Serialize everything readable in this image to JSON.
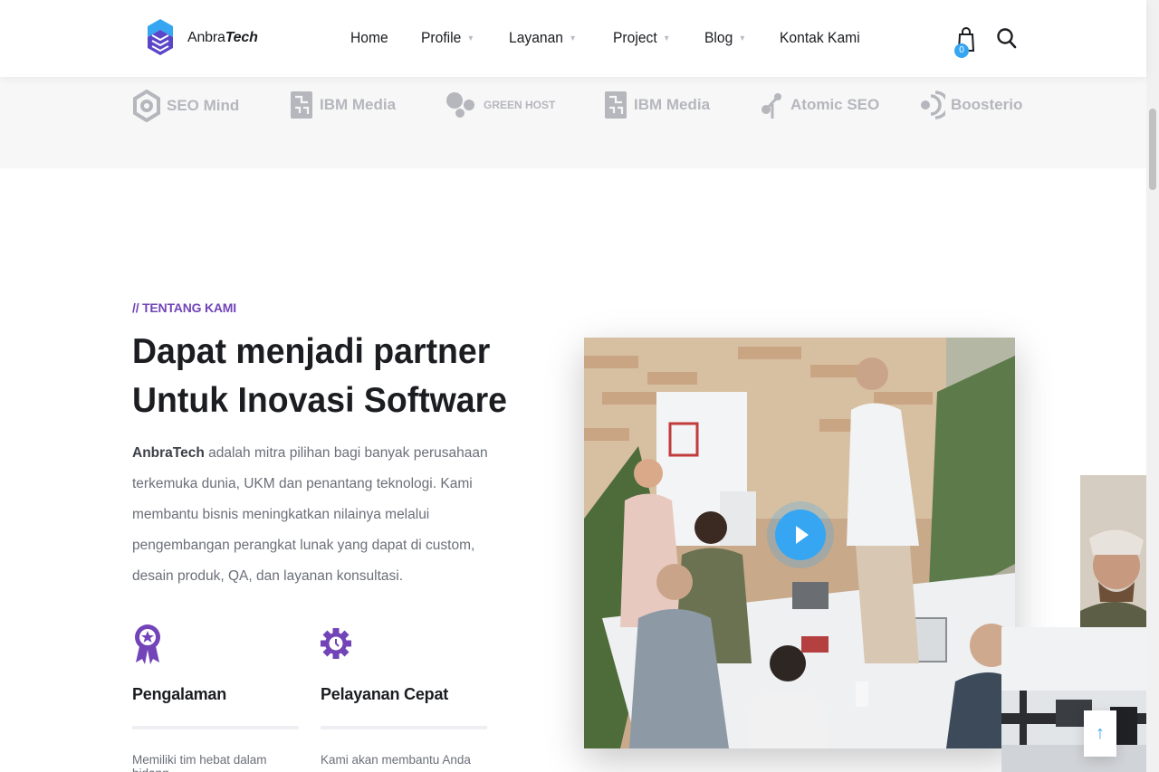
{
  "brand": {
    "prefix": "Anbra",
    "suffix": "Tech"
  },
  "nav": [
    {
      "label": "Home",
      "dropdown": false
    },
    {
      "label": "Profile",
      "dropdown": true
    },
    {
      "label": "Layanan",
      "dropdown": true
    },
    {
      "label": "Project",
      "dropdown": true
    },
    {
      "label": "Blog",
      "dropdown": true
    },
    {
      "label": "Kontak Kami",
      "dropdown": false
    }
  ],
  "nav_caret": "▼",
  "cart": {
    "count": "0",
    "icon": "shopping-bag-icon"
  },
  "search": {
    "icon": "search-icon"
  },
  "clients": [
    {
      "label": "SEO Mind",
      "icon": "seo-mind-logo"
    },
    {
      "label": "IBM Media",
      "icon": "ibm-media-logo"
    },
    {
      "label": "GREEN HOST",
      "icon": "green-host-logo"
    },
    {
      "label": "IBM Media",
      "icon": "ibm-media-logo"
    },
    {
      "label": "Atomic SEO",
      "icon": "atomic-seo-logo"
    },
    {
      "label": "Boosterio",
      "icon": "boosterio-logo"
    }
  ],
  "about": {
    "eyebrow": "// TENTANG KAMI",
    "headline_line1": "Dapat menjadi partner",
    "headline_line2": "Untuk Inovasi Software",
    "paragraph_bold": "AnbraTech",
    "paragraph_rest": " adalah mitra pilihan bagi banyak perusahaan terkemuka dunia, UKM dan penantang teknologi. Kami membantu bisnis meningkatkan nilainya melalui pengembangan perangkat lunak yang dapat di custom, desain produk, QA, dan layanan konsultasi."
  },
  "features": [
    {
      "title": "Pengalaman",
      "text": "Memiliki tim hebat dalam bidang",
      "icon": "award-ribbon-icon"
    },
    {
      "title": "Pelayanan Cepat",
      "text": "Kami akan membantu Anda",
      "icon": "gear-clock-icon"
    }
  ],
  "back_to_top": "↑",
  "colors": {
    "accent": "#7244b8",
    "primary": "#36a6f2",
    "text": "#1b1d21",
    "muted": "#6b6f78"
  }
}
